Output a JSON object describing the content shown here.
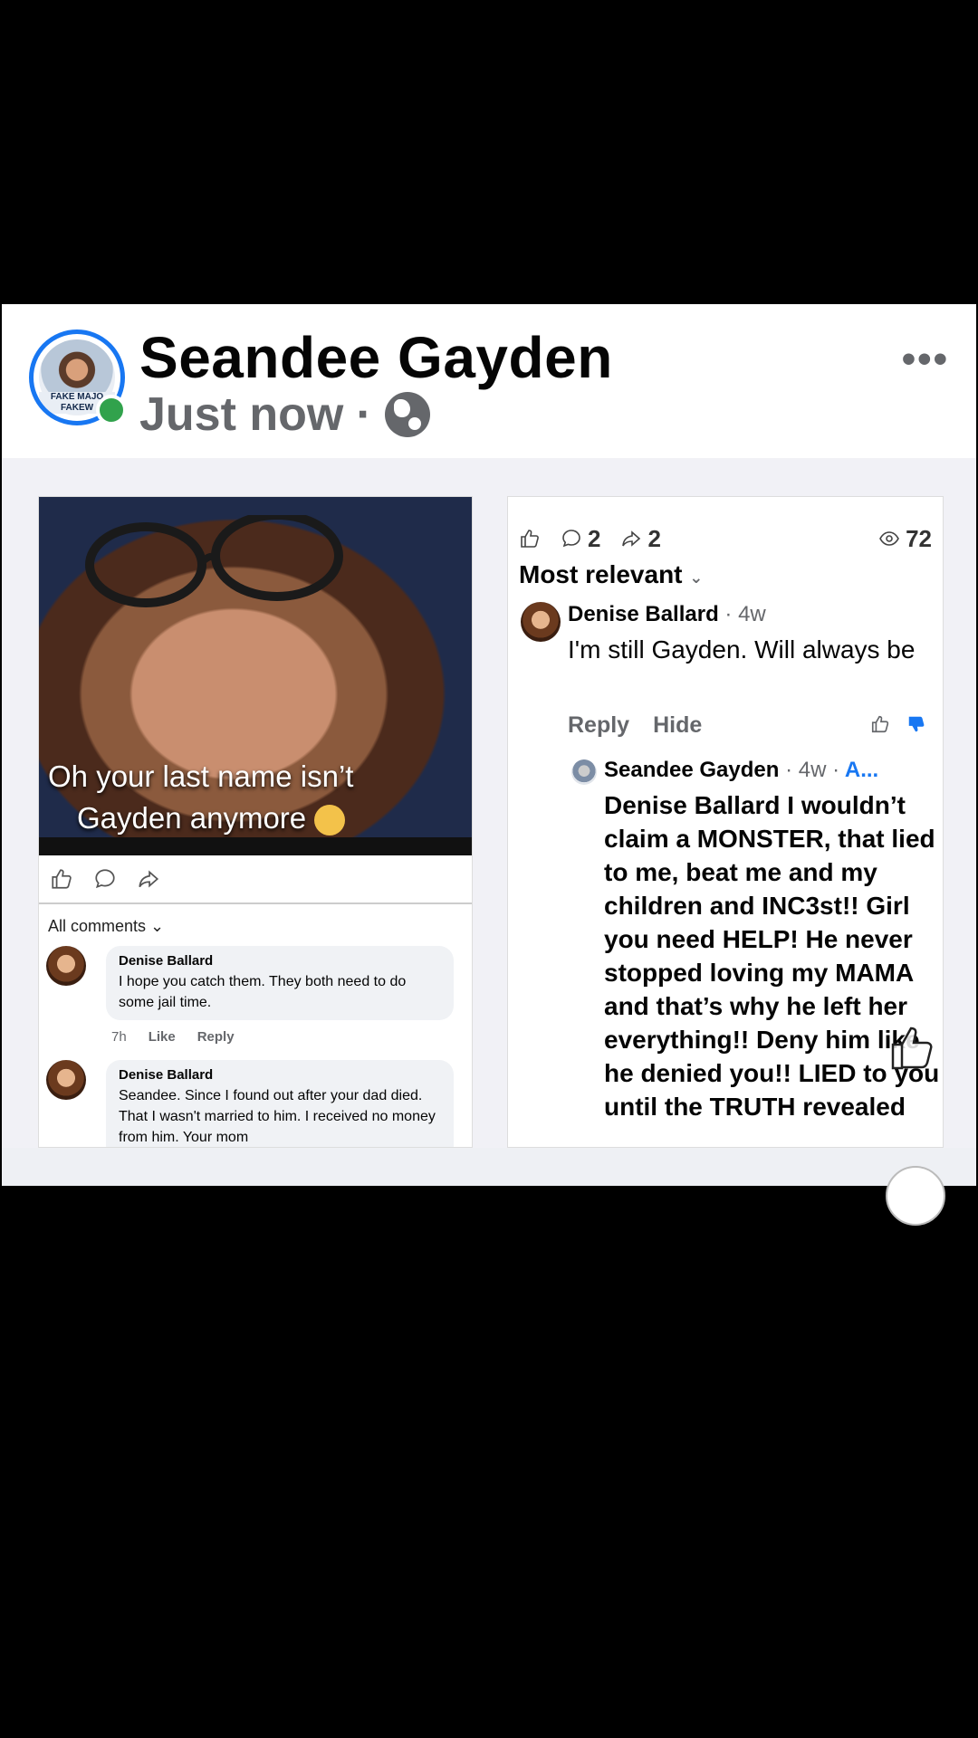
{
  "post": {
    "author": "Seandee Gayden",
    "time": "Just now",
    "separator": "·",
    "more_label": "•••",
    "avatar_banner": "FAKE MAJO FAKEW"
  },
  "left_panel": {
    "caption_line1": "Oh your last name isn’t",
    "caption_line2": "Gayden anymore",
    "all_comments_label": "All comments",
    "comments": [
      {
        "name": "Denise Ballard",
        "text": "I hope you catch them. They both need to do some jail time.",
        "time": "7h",
        "like": "Like",
        "reply": "Reply"
      },
      {
        "name": "Denise Ballard",
        "text": "Seandee. Since I found out after your dad died. That I wasn't married to him. I received no money from him. Your mom"
      }
    ]
  },
  "right_panel": {
    "comment_count": "2",
    "share_count": "2",
    "view_count": "72",
    "sort_label": "Most relevant",
    "comment1": {
      "name": "Denise Ballard",
      "time": "· 4w",
      "text": "I'm still Gayden. Will always be",
      "reply": "Reply",
      "hide": "Hide"
    },
    "comment2": {
      "name": "Seandee Gayden",
      "meta": "· 4w ·",
      "edit": "A...",
      "text": "Denise Ballard I wouldn’t claim a MONSTER, that lied to me, beat me and my children and INC3st!! Girl you need HELP! He never stopped loving my MAMA and that’s why he left her everything!! Deny him like he denied you!! LIED to you until the TRUTH revealed"
    }
  },
  "colors": {
    "accent": "#1877f2",
    "online": "#31a24c",
    "muted": "#65676b"
  },
  "icons": [
    "globe-icon",
    "more-icon",
    "like-icon",
    "comment-icon",
    "share-icon",
    "eye-icon",
    "chevron-down-icon",
    "thumbs-up-icon",
    "thumbs-down-icon"
  ]
}
